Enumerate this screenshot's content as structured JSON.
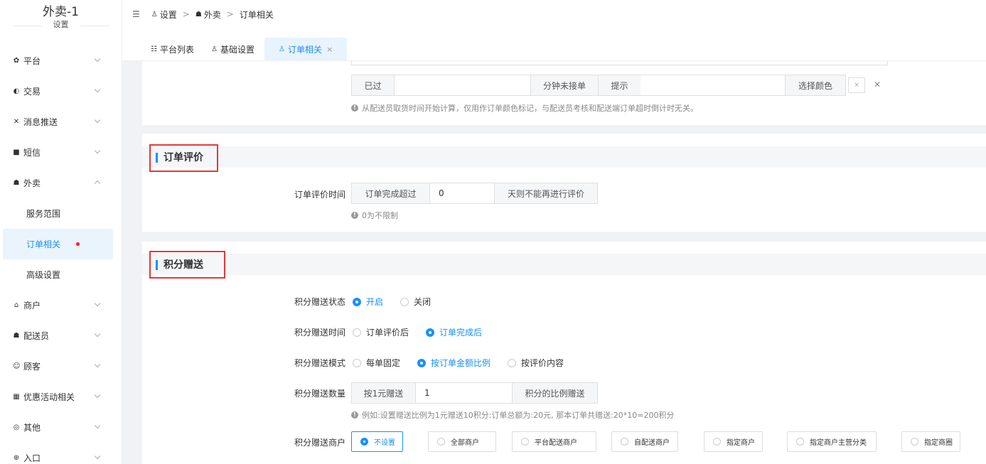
{
  "sidebar": {
    "title": "外卖-1",
    "subtitle": "设置",
    "items": [
      {
        "label": "平台",
        "icon": "gear-icon"
      },
      {
        "label": "交易",
        "icon": "trade-icon"
      },
      {
        "label": "消息推送",
        "icon": "push-icon"
      },
      {
        "label": "短信",
        "icon": "sms-icon"
      },
      {
        "label": "外卖",
        "icon": "takeout-icon"
      }
    ],
    "sub_items": [
      {
        "label": "服务范围"
      },
      {
        "label": "订单相关"
      },
      {
        "label": "高级设置"
      }
    ],
    "items_after": [
      {
        "label": "商户",
        "icon": "store-icon"
      },
      {
        "label": "配送员",
        "icon": "courier-icon"
      },
      {
        "label": "顾客",
        "icon": "customer-icon"
      },
      {
        "label": "优惠活动相关",
        "icon": "gift-icon"
      },
      {
        "label": "其他",
        "icon": "other-icon"
      },
      {
        "label": "入口",
        "icon": "entry-icon"
      }
    ]
  },
  "header": {
    "breadcrumb": [
      "设置",
      "外卖",
      "订单相关"
    ]
  },
  "tabs": [
    {
      "label": "平台列表"
    },
    {
      "label": "基础设置"
    },
    {
      "label": "订单相关"
    }
  ],
  "timeout_row": {
    "prefix": "已过",
    "value": "",
    "mid": "分钟未接单",
    "tip_label": "提示",
    "tip_value": "",
    "color_btn": "选择颜色",
    "hint": "从配送员取货时间开始计算，仅用作订单颜色标记，与配送员考核和配送端订单超时倒计时无关。"
  },
  "review": {
    "section_title": "订单评价",
    "label": "订单评价时间",
    "prefix": "订单完成超过",
    "value": "0",
    "suffix": "天则不能再进行评价",
    "hint": "0为不限制"
  },
  "points": {
    "section_title": "积分赠送",
    "status_label": "积分赠送状态",
    "status_options": [
      "开启",
      "关闭"
    ],
    "status_selected": "开启",
    "time_label": "积分赠送时间",
    "time_options": [
      "订单评价后",
      "订单完成后"
    ],
    "time_selected": "订单完成后",
    "mode_label": "积分赠送模式",
    "mode_options": [
      "每单固定",
      "按订单金额比例",
      "按评价内容"
    ],
    "mode_selected": "按订单金额比例",
    "amount_label": "积分赠送数量",
    "amount_prefix": "按1元赠送",
    "amount_value": "1",
    "amount_suffix": "积分的比例赠送",
    "amount_hint": "例如:设置赠送比例为1元赠送10积分:订单总额为:20元, 那本订单共赠送:20*10=200积分",
    "merchant_label": "积分赠送商户",
    "merchant_options": [
      "不设置",
      "全部商户",
      "平台配送商户",
      "自配送商户",
      "指定商户",
      "指定商户主营分类",
      "指定商圈"
    ],
    "merchant_selected": "不设置"
  },
  "colors": {
    "accent": "#1890ff",
    "highlight_box": "#e53935",
    "active_dot": "#f5222d"
  }
}
